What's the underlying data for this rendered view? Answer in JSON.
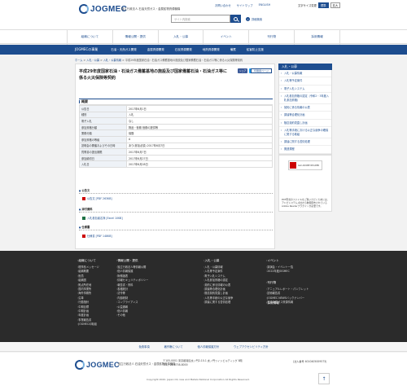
{
  "header": {
    "logo_text": "JOGMEC",
    "logo_sub": "独立行政法人 石油天然ガス・金属鉱物資源機構",
    "utility_links": [
      "お問い合わせ",
      "サイトマップ",
      "ENGLISH",
      "文字サイズ変更"
    ],
    "size_buttons": [
      "標準",
      "拡大"
    ],
    "search_placeholder": "サイト内検索",
    "advanced_search": "詳細検索"
  },
  "global_nav": [
    "組織について",
    "情報公開・提供",
    "入札・公募",
    "イベント",
    "刊行物",
    "採用情報"
  ],
  "business_nav": [
    "JOGMECの事業",
    "石油・天然ガス開発",
    "金属資源開発",
    "石炭資源開発",
    "地熱資源開発",
    "備蓄",
    "鉱害防止支援"
  ],
  "breadcrumb": [
    "ホーム",
    "入札・公募",
    "入札・公募情報",
    "平成29年度国家石油・石油ガス備蓄基地の施設及び国家備蓄石油・石油ガス等に係る火災保険等契約"
  ],
  "page": {
    "title": "平成29年度国家石油・石油ガス備蓄基地の施設及び国家備蓄石油・石油ガス等に係る火災保険等契約",
    "share_fb": "シェア",
    "share_tw": "ツイート",
    "print": "印刷用ページ",
    "section_overview": "概要",
    "overview_rows": [
      {
        "k": "公告日",
        "v": "2017年6月1日"
      },
      {
        "k": "種別",
        "v": "入札"
      },
      {
        "k": "電子入札",
        "v": "なし"
      },
      {
        "k": "参加資格分類",
        "v": "物品・役務 役務の提供等"
      },
      {
        "k": "業務分類",
        "v": "保険"
      },
      {
        "k": "参加資格の等級",
        "v": "A"
      },
      {
        "k": "説明会の開催およびその日時",
        "v": "あり(参加必須) 2017年6月7日"
      },
      {
        "k": "質問書の提出期限",
        "v": "2017年6月7日"
      },
      {
        "k": "参加締切日",
        "v": "2017年6月27日"
      },
      {
        "k": "入札日",
        "v": "2017年6月28日"
      }
    ],
    "sub_notice": "公告文",
    "file_notice": "公告文 [PDF 263KB]",
    "sub_attach": "添付資料",
    "file_attach": "入札参加者名簿 [Excel 10KB]",
    "sub_spec": "仕様書",
    "file_spec": "仕様書 [PDF 148KB]"
  },
  "sidebar": {
    "heading": "入札・公募",
    "items": [
      "入札・公募情報",
      "入札等予定案件",
      "電子入札システム",
      "入札参加資格の認定（令和2・3年度入札参加資格）",
      "契約に係る情報の公表",
      "調達等合理化計画",
      "随意契約見直し計画",
      "入札等手続における公正な競争の確保に関する取組",
      "調達に関する苦情処理",
      "関連規程"
    ]
  },
  "reader": {
    "badge": "Get ADOBE READER",
    "note": "PDF形式のファイルをご覧いただくためには、アドビシステムズ社から無償配布されているAdobe Readerプラグインが必要です。"
  },
  "footer": {
    "cols": [
      {
        "h": "組織について",
        "items": [
          "理事長メッセージ",
          "組織概要",
          "役員",
          "組織図",
          "拠点所在地",
          "国内事業所",
          "海外事務所",
          "沿革",
          "行動指針",
          "中期目標",
          "中期計画",
          "年度計画",
          "事業報告書",
          "JOGMECの取組"
        ]
      },
      {
        "h": "情報公開・提供",
        "items": [
          "独立行政法人等情報公開",
          "個人情報保護",
          "財務諸表",
          "情報セキュリティポリシー",
          "報告書・資料",
          "各種統計",
          "法令等",
          "内部統制",
          "コンプライアンス",
          "公益通報",
          "個人情報",
          "その他"
        ]
      },
      {
        "h": "入札・公募",
        "items": [
          "入札・公募情報",
          "入札等予定案件",
          "電子入札システム",
          "入札参加資格の認定",
          "契約に係る情報の公表",
          "調達等合理化計画",
          "随意契約見直し計画",
          "入札等手続の公正な競争",
          "調達に関する苦情処理"
        ]
      },
      {
        "h": "イベント",
        "items": [
          "講演会・イベント一覧",
          "2022年度JOGMEC"
        ]
      },
      {
        "h": "刊行物",
        "items": [
          "アニュアルレポート・パンフレット",
          "技術報告書",
          "JOGMEC NEWSバックナンバー",
          "石油天然ガス資源情報"
        ]
      },
      {
        "h": "採用情報",
        "items": []
      }
    ],
    "links": [
      "免責事項",
      "著作権について",
      "個人情報保護方針",
      "ウェブアクセシビリティ方針"
    ],
    "org": "独立行政法人 石油天然ガス・金属鉱物資源機構",
    "address": "〒105-0001 東京都港区虎ノ門2-10-1 虎ノ門ツインビルディング 8階",
    "tel": "TEL：03-6758-8000",
    "representative": "(法人番号 4010405009573)",
    "copyright": "Copyright 2020. Japan Oil, Gas and Metals National Corporation All Rights Reserved.",
    "to_top": "↑"
  }
}
